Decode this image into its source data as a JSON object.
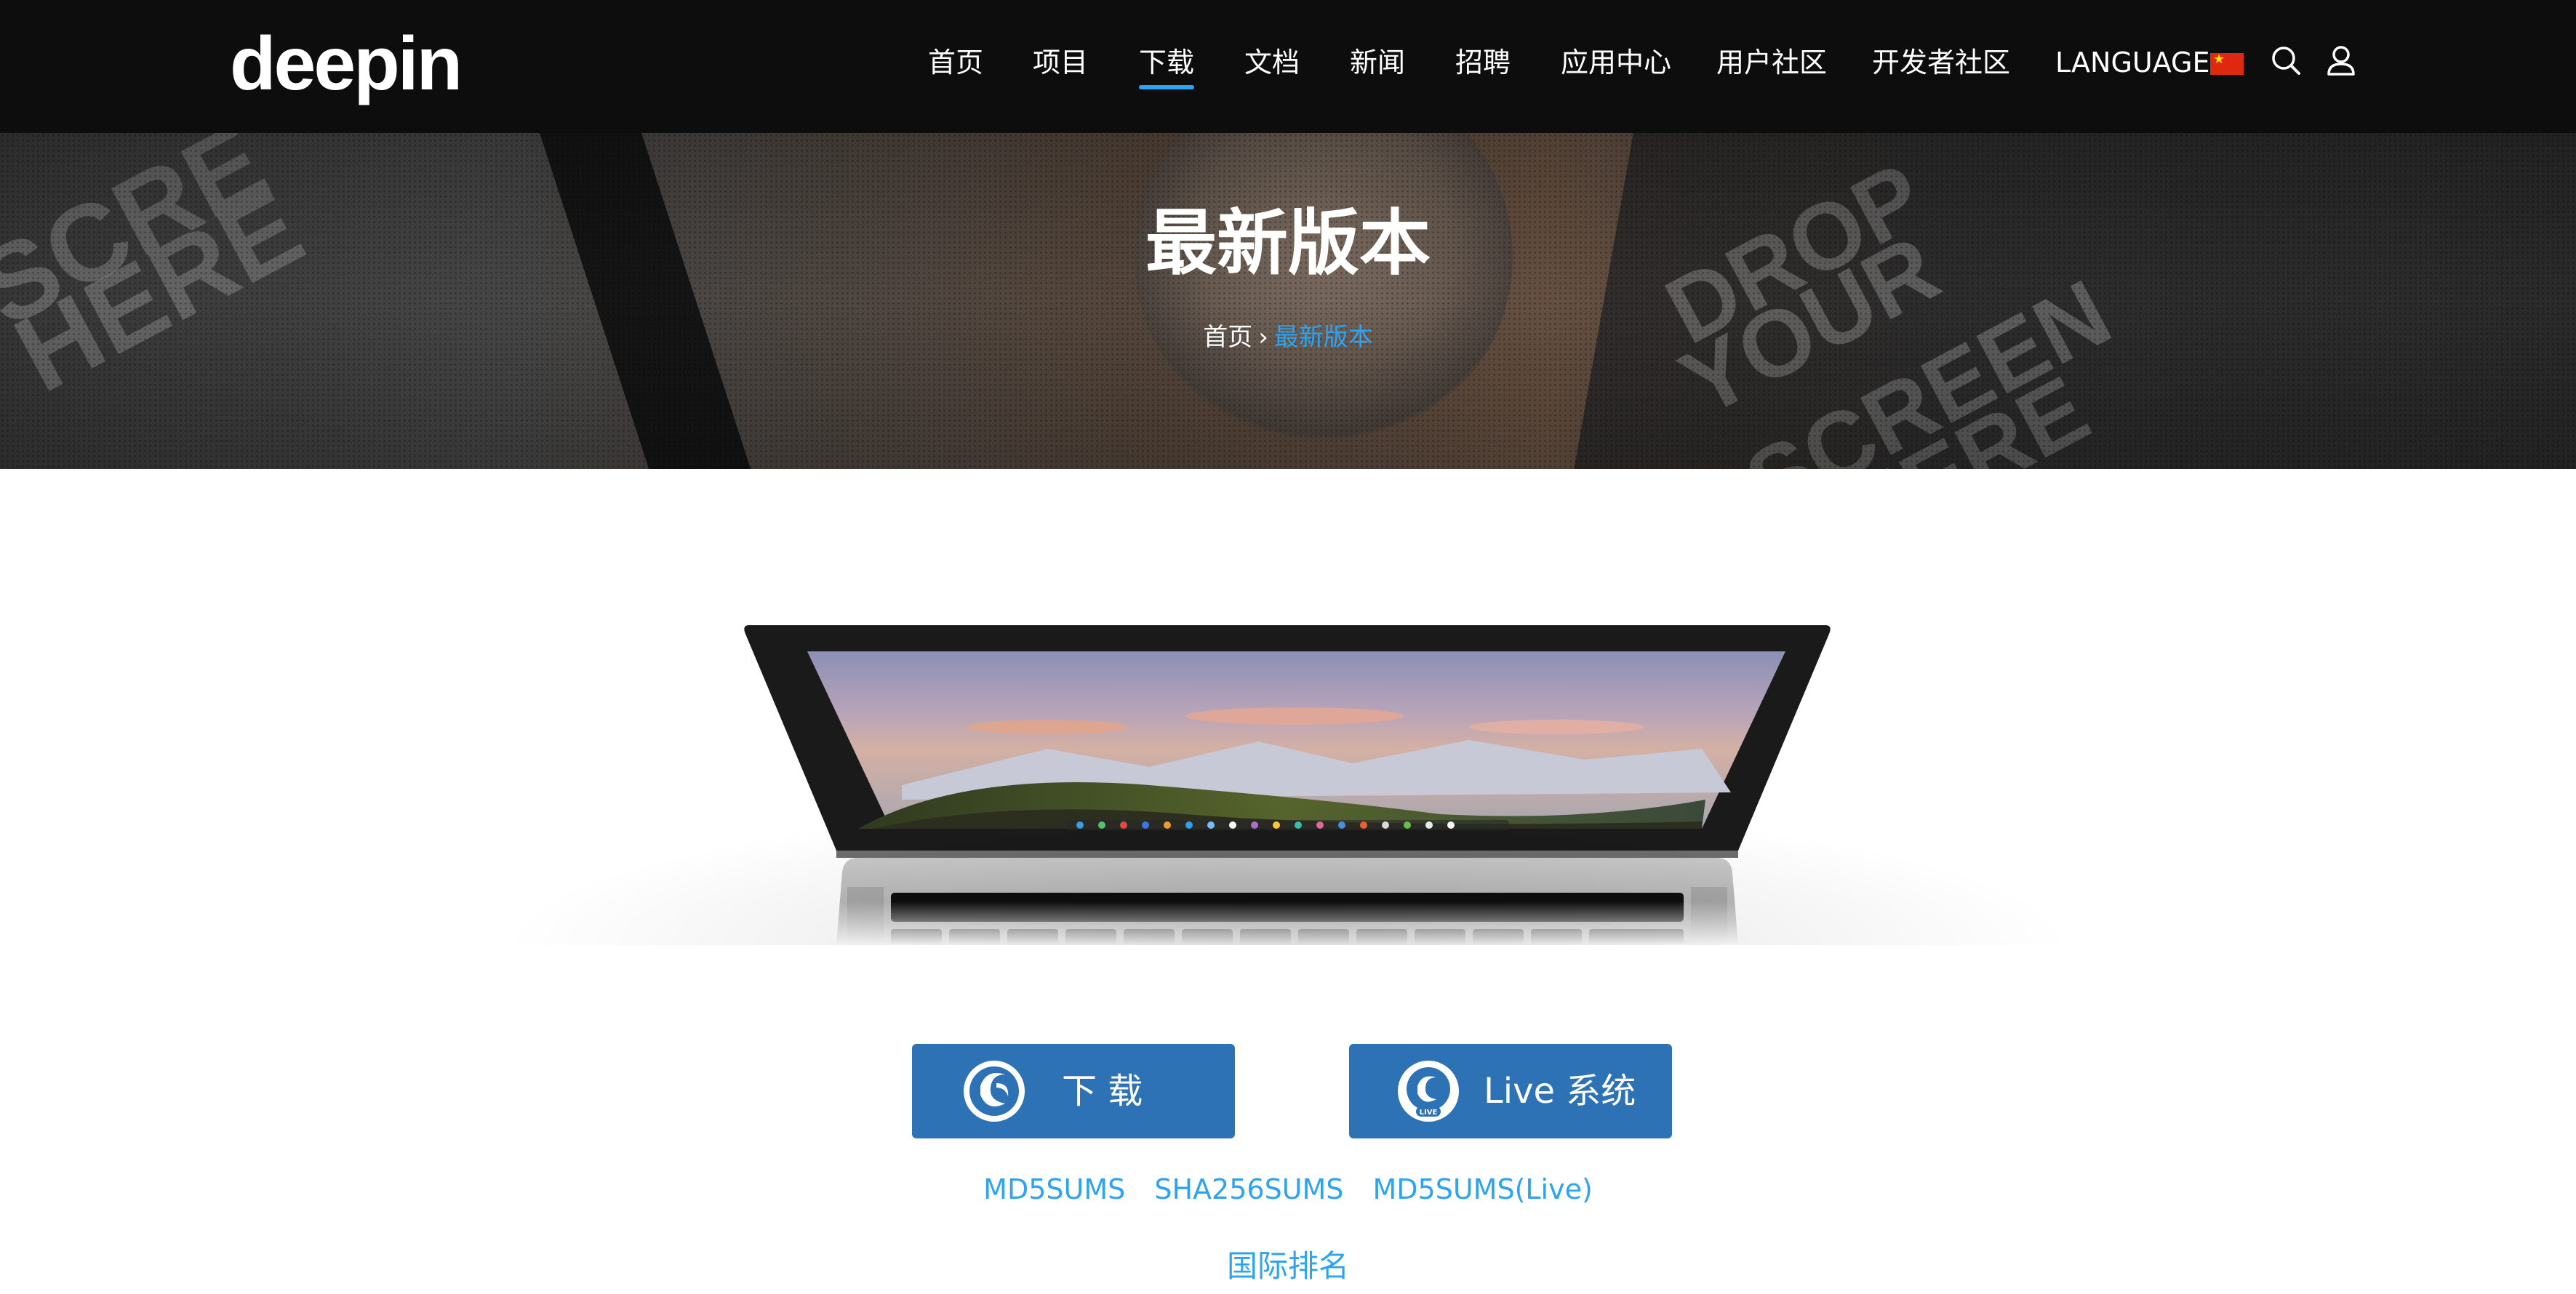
{
  "header": {
    "logo_text": "deepin",
    "nav": [
      {
        "label": "首页"
      },
      {
        "label": "项目"
      },
      {
        "label": "下载",
        "active": true
      },
      {
        "label": "文档"
      },
      {
        "label": "新闻"
      },
      {
        "label": "招聘"
      },
      {
        "label": "应用中心"
      },
      {
        "label": "用户社区"
      },
      {
        "label": "开发者社区"
      }
    ],
    "language_label": "LANGUAGE:",
    "flag": "china-flag-icon",
    "icons": [
      "search-icon",
      "user-icon"
    ]
  },
  "banner": {
    "title": "最新版本",
    "breadcrumb_home": "首页",
    "breadcrumb_sep": "›",
    "breadcrumb_current": "最新版本"
  },
  "actions": {
    "download_label": "下 载",
    "download_icon": "deepin-logo-icon",
    "live_label": "Live 系统",
    "live_icon": "deepin-live-logo-icon"
  },
  "links": {
    "md5": "MD5SUMS",
    "sha256": "SHA256SUMS",
    "md5_live": "MD5SUMS(Live)",
    "rank": "国际排名"
  },
  "colors": {
    "header_bg": "#0d0d0d",
    "accent": "#2ea3f2",
    "button_bg": "#2e72b6"
  }
}
